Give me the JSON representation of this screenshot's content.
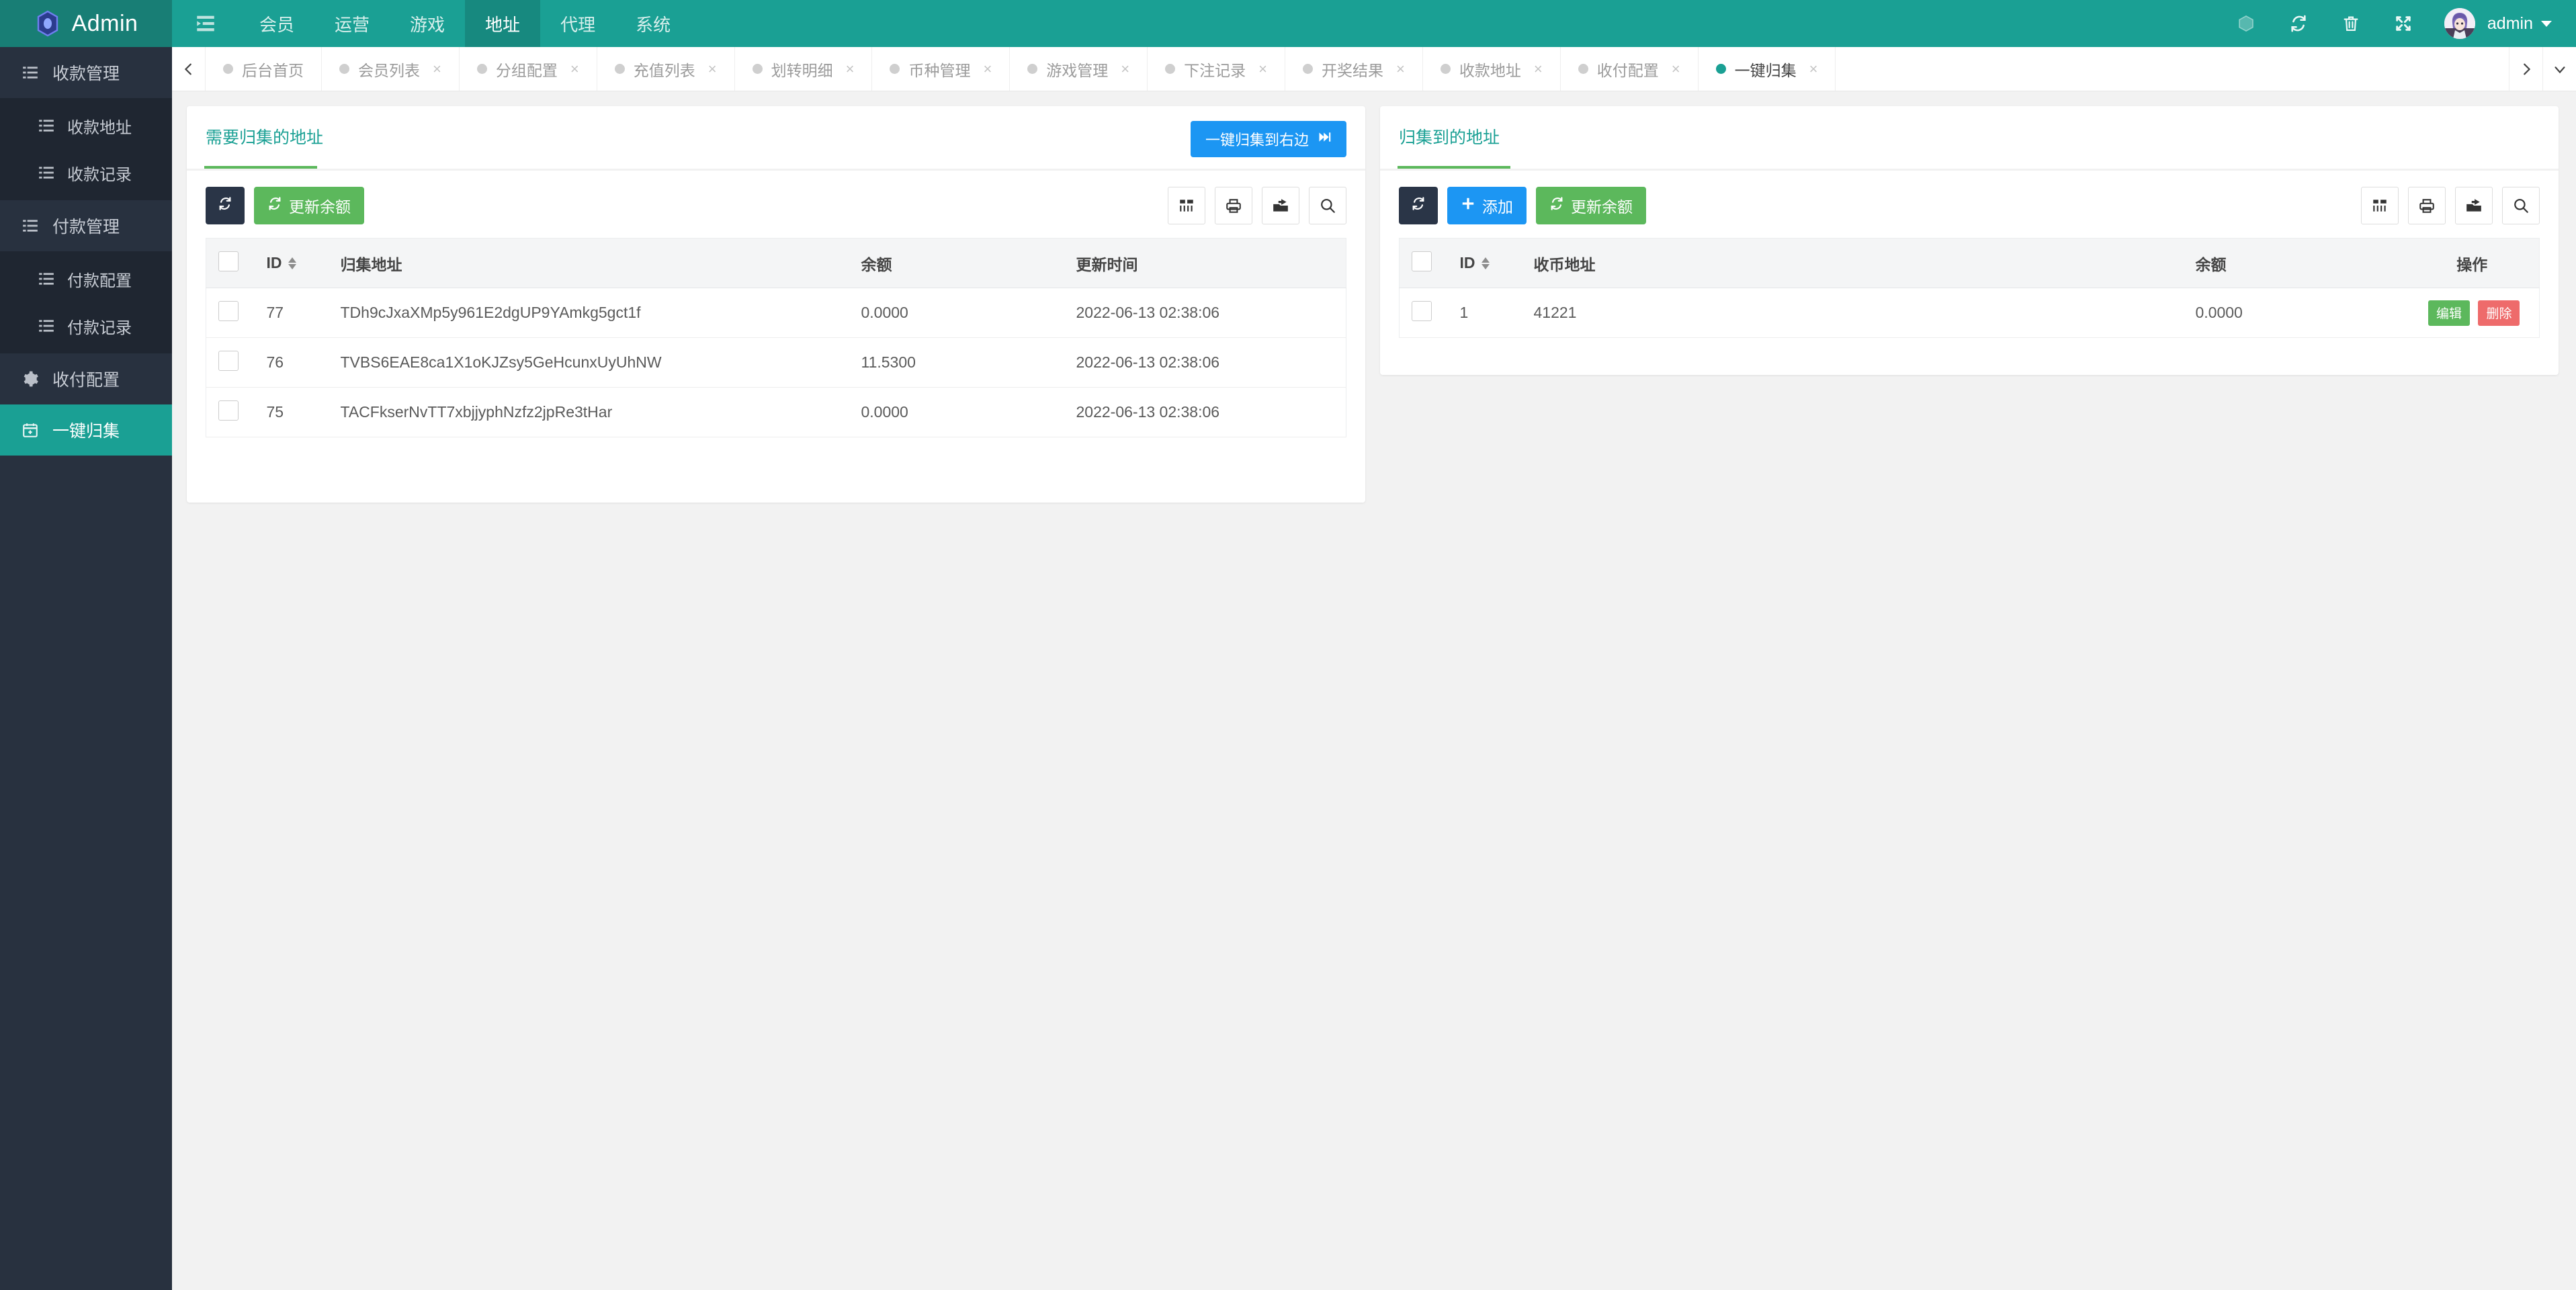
{
  "brand": {
    "title": "Admin",
    "logo_icon": "hexagon-logo-icon"
  },
  "navbar": {
    "toggle_icon": "sidebar-collapse-icon",
    "menu": [
      {
        "label": "会员",
        "active": false
      },
      {
        "label": "运营",
        "active": false
      },
      {
        "label": "游戏",
        "active": false
      },
      {
        "label": "地址",
        "active": true
      },
      {
        "label": "代理",
        "active": false
      },
      {
        "label": "系统",
        "active": false
      }
    ],
    "right_icons": [
      "theme-hexagon-icon",
      "refresh-icon",
      "trash-icon",
      "fullscreen-icon"
    ],
    "user": "admin"
  },
  "tabbar": {
    "prev_icon": "chevron-left-icon",
    "next_icon": "chevron-right-icon",
    "more_icon": "chevron-down-icon",
    "close_glyph": "×",
    "tabs": [
      {
        "label": "后台首页",
        "active": false,
        "closable": false
      },
      {
        "label": "会员列表",
        "active": false,
        "closable": true
      },
      {
        "label": "分组配置",
        "active": false,
        "closable": true
      },
      {
        "label": "充值列表",
        "active": false,
        "closable": true
      },
      {
        "label": "划转明细",
        "active": false,
        "closable": true
      },
      {
        "label": "币种管理",
        "active": false,
        "closable": true
      },
      {
        "label": "游戏管理",
        "active": false,
        "closable": true
      },
      {
        "label": "下注记录",
        "active": false,
        "closable": true
      },
      {
        "label": "开奖结果",
        "active": false,
        "closable": true
      },
      {
        "label": "收款地址",
        "active": false,
        "closable": true
      },
      {
        "label": "收付配置",
        "active": false,
        "closable": true
      },
      {
        "label": "一键归集",
        "active": true,
        "closable": true
      }
    ]
  },
  "sidebar": {
    "groups": [
      {
        "label": "收款管理",
        "icon": "list-icon",
        "items": [
          {
            "label": "收款地址",
            "icon": "list-icon"
          },
          {
            "label": "收款记录",
            "icon": "list-icon"
          }
        ]
      },
      {
        "label": "付款管理",
        "icon": "list-icon",
        "items": [
          {
            "label": "付款配置",
            "icon": "list-icon"
          },
          {
            "label": "付款记录",
            "icon": "list-icon"
          }
        ]
      }
    ],
    "singles": [
      {
        "label": "收付配置",
        "icon": "gear-icon",
        "active": false
      },
      {
        "label": "一键归集",
        "icon": "calendar-plus-icon",
        "active": true
      }
    ]
  },
  "left_panel": {
    "tab_label": "需要归集的地址",
    "collect_button": {
      "label": "一键归集到右边",
      "icon": "forward-step-icon",
      "color": "#1c96f3"
    },
    "toolbar": {
      "refresh_icon": "refresh-icon",
      "update_balance_label": "更新余额",
      "icons": [
        "columns-icon",
        "print-icon",
        "export-icon",
        "search-icon"
      ]
    },
    "table": {
      "columns": [
        "",
        "ID",
        "归集地址",
        "余额",
        "更新时间"
      ],
      "rows": [
        {
          "id": "77",
          "address": "TDh9cJxaXMp5y961E2dgUP9YAmkg5gct1f",
          "balance": "0.0000",
          "updated_at": "2022-06-13 02:38:06"
        },
        {
          "id": "76",
          "address": "TVBS6EAE8ca1X1oKJZsy5GeHcunxUyUhNW",
          "balance": "11.5300",
          "updated_at": "2022-06-13 02:38:06"
        },
        {
          "id": "75",
          "address": "TACFkserNvTT7xbjjyphNzfz2jpRe3tHar",
          "balance": "0.0000",
          "updated_at": "2022-06-13 02:38:06"
        }
      ]
    }
  },
  "right_panel": {
    "tab_label": "归集到的地址",
    "toolbar": {
      "refresh_icon": "refresh-icon",
      "add_label": "添加",
      "update_balance_label": "更新余额",
      "icons": [
        "columns-icon",
        "print-icon",
        "export-icon",
        "search-icon"
      ]
    },
    "table": {
      "columns": [
        "",
        "ID",
        "收币地址",
        "余额",
        "操作"
      ],
      "rows": [
        {
          "id": "1",
          "address": "41221",
          "balance": "0.0000",
          "edit_label": "编辑",
          "delete_label": "删除"
        }
      ]
    }
  },
  "colors": {
    "brand_teal": "#1aa094",
    "brand_teal_dark": "#187e75",
    "sidebar_bg": "#28313f",
    "sidebar_sub_bg": "#1f2631",
    "green": "#5cb85c",
    "blue": "#1c96f3",
    "red": "#ee6b6b",
    "dark_btn": "#2a3547"
  }
}
